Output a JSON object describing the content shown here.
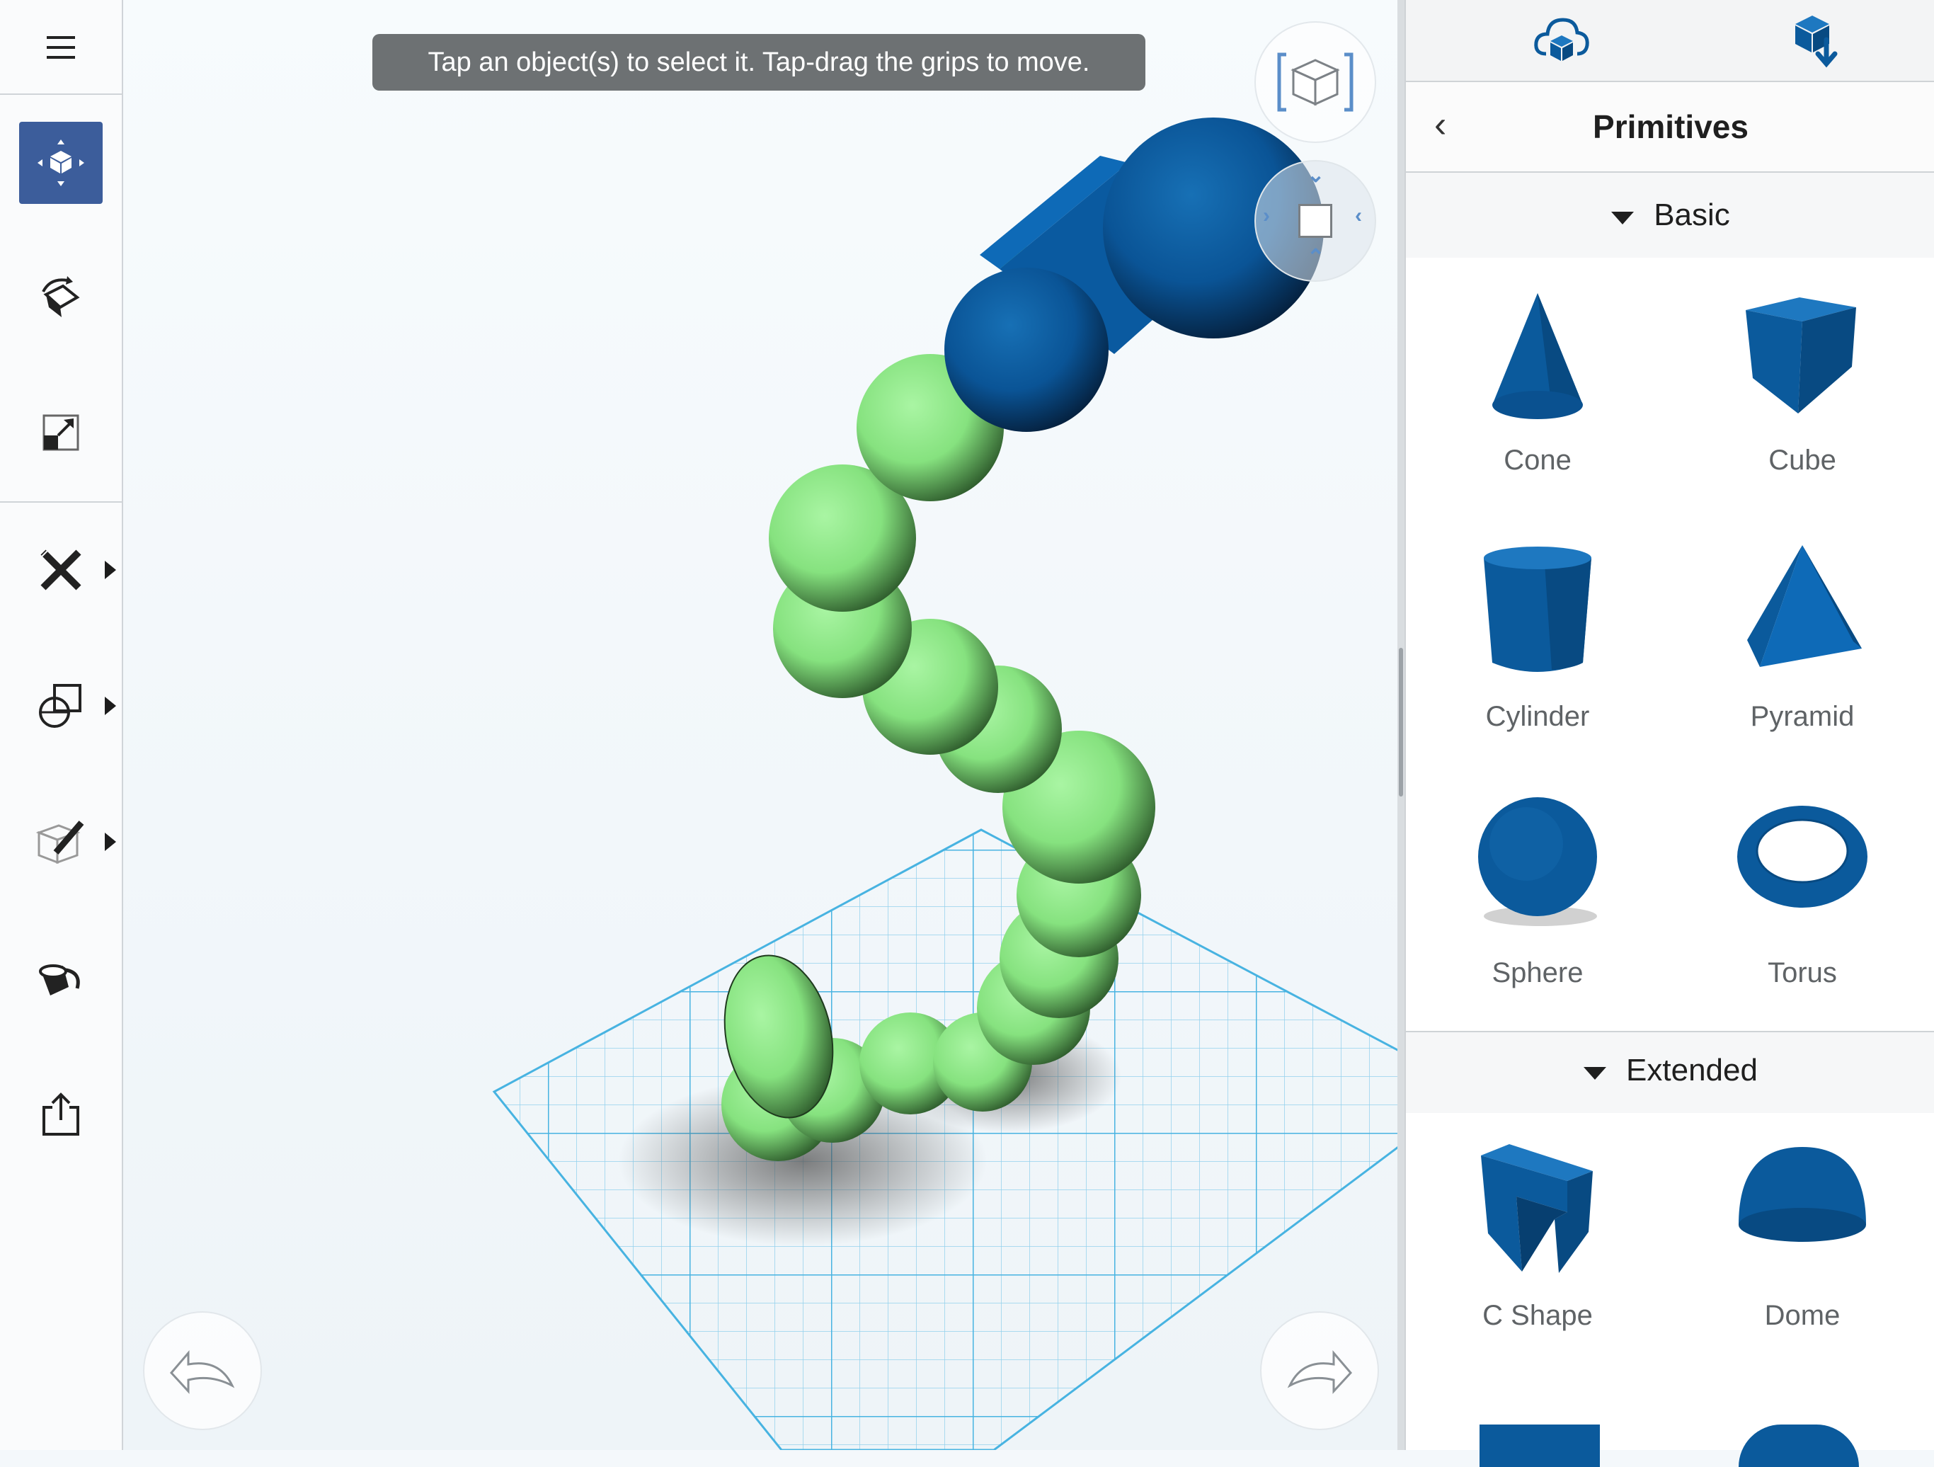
{
  "toolbar": {
    "menu_icon": "hamburger-icon",
    "tools": [
      {
        "name": "move-tool",
        "icon": "move-cube-icon",
        "active": true
      },
      {
        "name": "rotate-tool",
        "icon": "rotate-icon"
      },
      {
        "name": "scale-tool",
        "icon": "scale-icon"
      },
      {
        "name": "modify-tool",
        "icon": "pencil-ruler-icon",
        "has_flyout": true
      },
      {
        "name": "combine-tool",
        "icon": "shapes-icon",
        "has_flyout": true
      },
      {
        "name": "edit-tool",
        "icon": "box-pencil-icon",
        "has_flyout": true
      },
      {
        "name": "paint-tool",
        "icon": "paint-bucket-icon"
      },
      {
        "name": "export-tool",
        "icon": "share-icon"
      }
    ]
  },
  "viewport": {
    "hint": "Tap an object(s) to select it. Tap-drag the grips to move.",
    "undo_icon": "undo-icon",
    "redo_icon": "redo-icon",
    "colors": {
      "green": "#8ee88a",
      "blue": "#0a5aa0",
      "grid": "#5cc0e6"
    }
  },
  "panel": {
    "top_icons": [
      "cloud-box-icon",
      "box-download-icon"
    ],
    "title": "Primitives",
    "sections": [
      {
        "name": "Basic",
        "items": [
          "Cone",
          "Cube",
          "Cylinder",
          "Pyramid",
          "Sphere",
          "Torus"
        ]
      },
      {
        "name": "Extended",
        "items": [
          "C Shape",
          "Dome"
        ]
      }
    ],
    "accent": "#0b5a9c"
  }
}
